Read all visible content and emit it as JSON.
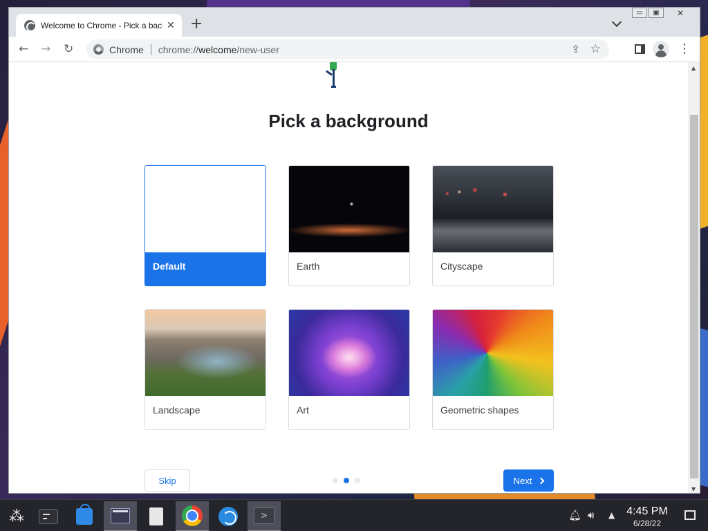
{
  "browser": {
    "tab_title": "Welcome to Chrome - Pick a background",
    "new_tab_symbol": "+",
    "tab_close_symbol": "✕",
    "omnibox_label": "Chrome",
    "url_scheme": "chrome://",
    "url_host": "welcome",
    "url_path": "/new-user",
    "window_controls": {
      "minimize": "▭",
      "maximize": "▣",
      "close": "✕"
    }
  },
  "page": {
    "title": "Pick a background",
    "backgrounds": [
      {
        "label": "Default",
        "selected": true,
        "icon": "default-background"
      },
      {
        "label": "Earth",
        "selected": false,
        "icon": "earth-background"
      },
      {
        "label": "Cityscape",
        "selected": false,
        "icon": "cityscape-background"
      },
      {
        "label": "Landscape",
        "selected": false,
        "icon": "landscape-background"
      },
      {
        "label": "Art",
        "selected": false,
        "icon": "art-background"
      },
      {
        "label": "Geometric shapes",
        "selected": false,
        "icon": "geometric-background"
      }
    ],
    "skip_label": "Skip",
    "next_label": "Next",
    "step_dots": {
      "count": 3,
      "active_index": 1
    }
  },
  "taskbar": {
    "apps": [
      "launcher",
      "system-monitor",
      "discover-store",
      "file-manager",
      "text-editor",
      "chrome",
      "web-browser",
      "terminal"
    ],
    "active_app": "chrome",
    "clock_time": "4:45 PM",
    "clock_date": "6/28/22"
  },
  "colors": {
    "accent": "#1a73e8",
    "taskbar_bg": "#24252b"
  }
}
